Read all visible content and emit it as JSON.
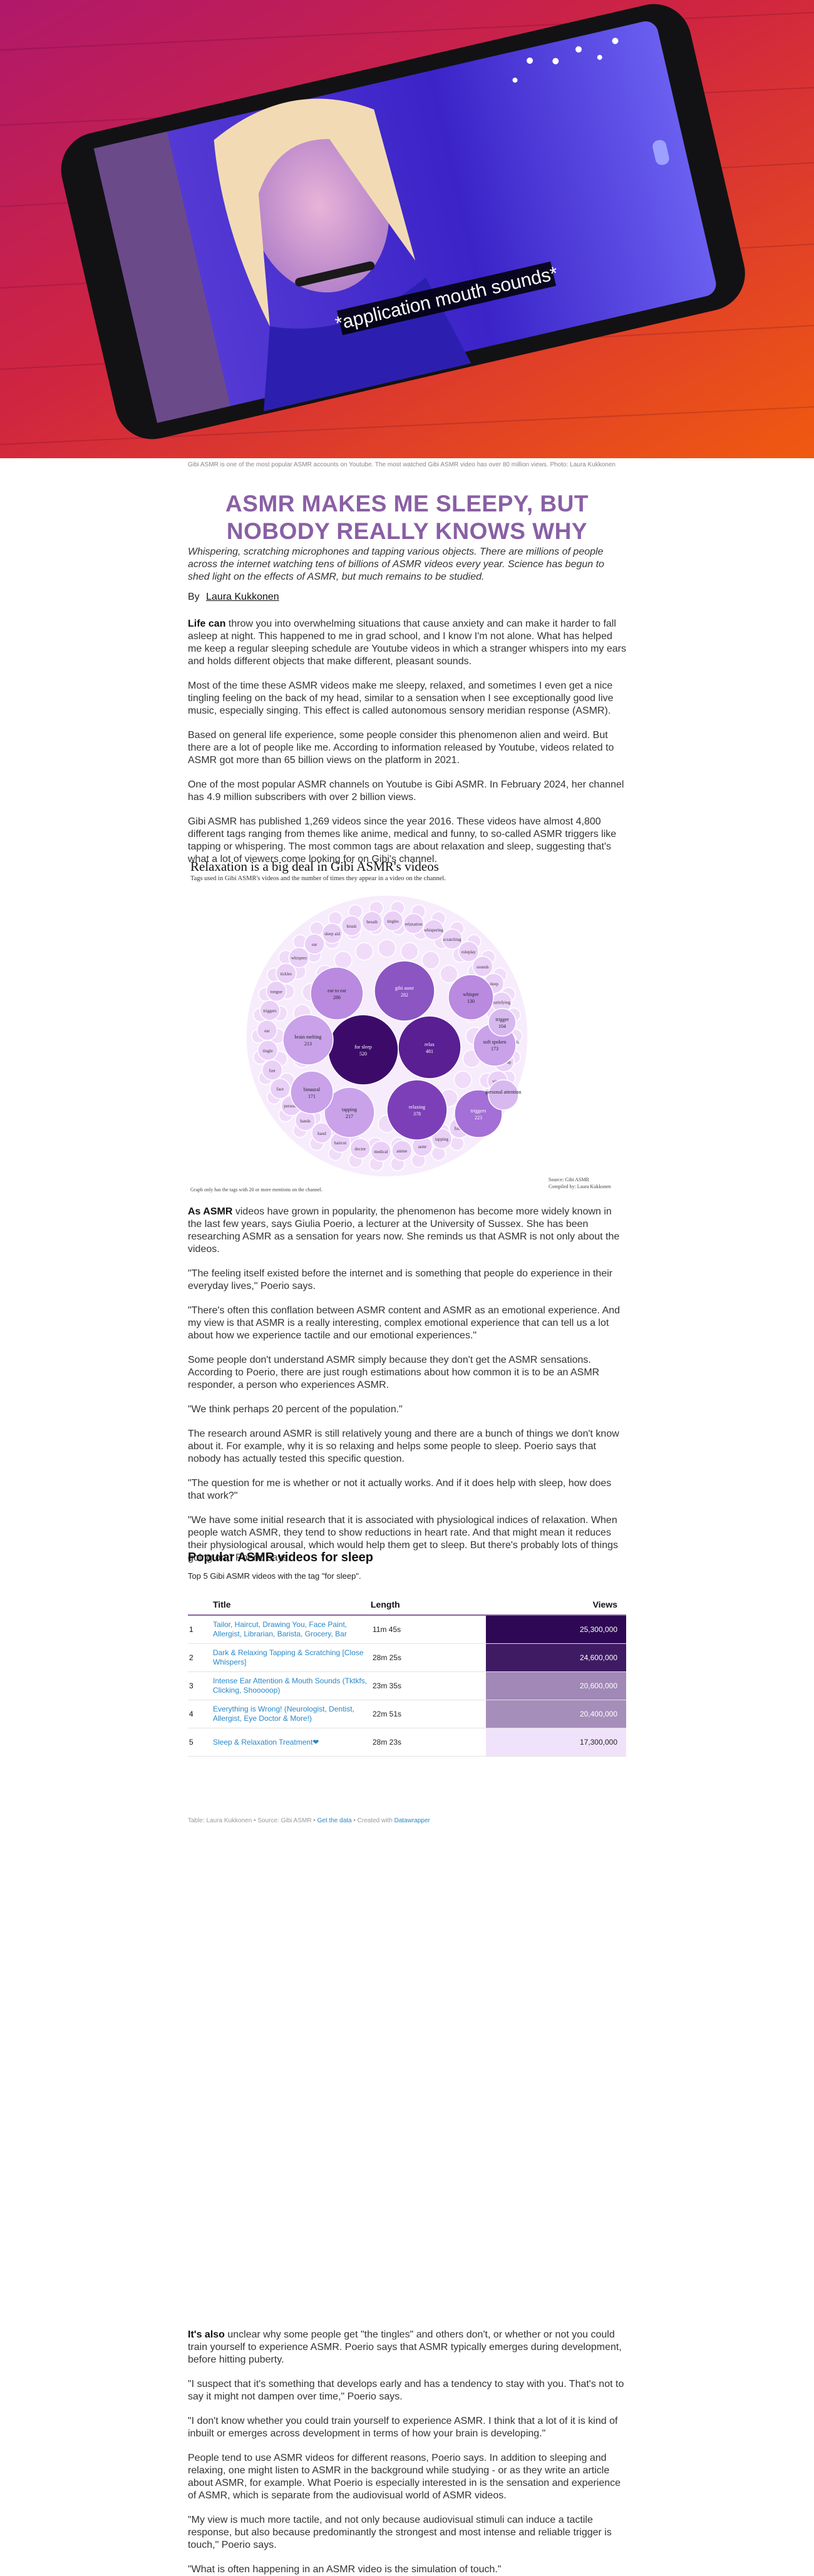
{
  "hero": {
    "subtitle_overlay": "*application mouth sounds*"
  },
  "caption": "Gibi ASMR is one of the most popular ASMR accounts on Youtube. The most watched Gibi ASMR video has over 80 million views. Photo: Laura Kukkonen",
  "headline": "ASMR MAKES ME SLEEPY, BUT NOBODY REALLY KNOWS WHY",
  "lead": "Whispering, scratching microphones and tapping various objects. There are millions of people across the internet watching tens of billions of ASMR videos every year. Science has begun to shed light on the effects of ASMR, but much remains to be studied.",
  "byline": {
    "prefix": "By",
    "author": "Laura Kukkonen"
  },
  "intro_paragraphs": [
    {
      "lead": "Life can",
      "text": " throw you into overwhelming situations that cause anxiety and can make it harder to fall asleep at night. This happened to me in grad school, and I know I'm not alone. What has helped me keep a regular sleeping schedule are Youtube videos in which a stranger whispers into my ears and holds different objects that make different, pleasant sounds."
    },
    {
      "lead": "",
      "text": "Most of the time these ASMR videos make me sleepy, relaxed, and sometimes I even get a nice tingling feeling on the back of my head, similar to a sensation when I see exceptionally good live music, especially singing. This effect is called autonomous sensory meridian response (ASMR)."
    },
    {
      "lead": "",
      "text": "Based on general life experience, some people consider this phenomenon alien and weird. But there are a lot of people like me. According to information released by Youtube, videos related to ASMR got more than 65 billion views on the platform in 2021."
    },
    {
      "lead": "",
      "text": "One of the most popular ASMR channels on Youtube is Gibi ASMR. In February 2024, her channel has 4.9 million subscribers with over 2 billion views."
    },
    {
      "lead": "",
      "text": "Gibi ASMR has published 1,269 videos since the year 2016. These videos have almost 4,800 different tags ranging from themes like anime, medical and funny, to so-called ASMR triggers like tapping or whispering. The most common tags are about relaxation and sleep, suggesting that's what a lot of viewers come looking for on Gibi's channel."
    }
  ],
  "bubble_chart": {
    "title": "Relaxation is a big deal in Gibi ASMR's videos",
    "subtitle": "Tags used in Gibi ASMR's videos and the number of times they appear in a video on the channel.",
    "footnote": "Graph only has the tags with 20 or more mentions on the channel.",
    "source": "Source: Gibi ASMR",
    "compiled": "Compiled by: Laura Kukkonen",
    "big": [
      {
        "label": "for sleep",
        "value": "520"
      },
      {
        "label": "relax",
        "value": "481"
      },
      {
        "label": "relaxing",
        "value": "378"
      },
      {
        "label": "gibi asmr",
        "value": "282"
      },
      {
        "label": "ear to ear",
        "value": "286"
      },
      {
        "label": "brain melting",
        "value": "213"
      },
      {
        "label": "tapping",
        "value": "217"
      },
      {
        "label": "binaural",
        "value": "171"
      },
      {
        "label": "triggers",
        "value": "223"
      },
      {
        "label": "whisper",
        "value": "130"
      },
      {
        "label": "soft spoken",
        "value": "173"
      },
      {
        "label": "trigger",
        "value": "104"
      },
      {
        "label": "personal attention",
        "value": ""
      }
    ],
    "small": [
      "tingles",
      "relaxation",
      "whispering",
      "scratching",
      "roleplay",
      "sounds",
      "sleep",
      "satisfying",
      "brushing",
      "mouth sounds",
      "close up",
      "visual",
      "unintelligible",
      "roleplay",
      "funny",
      "tapping",
      "asmr",
      "anime",
      "medical",
      "doctor",
      "haircut",
      "hand",
      "hands",
      "personal",
      "face",
      "fast",
      "tingle",
      "ear",
      "triggers",
      "tongue",
      "tickles",
      "whispers",
      "ear",
      "sleep aid",
      "brush",
      "breath"
    ]
  },
  "mid_paragraphs": [
    {
      "lead": "As ASMR",
      "text": " videos have grown in popularity, the phenomenon has become more widely known in the last few years, says Giulia Poerio, a lecturer at the University of Sussex. She has been researching ASMR as a sensation for years now. She reminds us that ASMR is not only about the videos."
    },
    {
      "lead": "",
      "text": "\"The feeling itself existed before the internet and is something that people do experience in their everyday lives,\" Poerio says."
    },
    {
      "lead": "",
      "text": "\"There's often this conflation between ASMR content and ASMR as an emotional experience. And my view is that ASMR is a really interesting, complex emotional experience that can tell us a lot about how we experience tactile and our emotional experiences.\""
    },
    {
      "lead": "",
      "text": "Some people don't understand ASMR simply because they don't get the ASMR sensations. According to Poerio, there are just rough estimations about how common it is to be an ASMR responder, a person who experiences ASMR."
    },
    {
      "lead": "",
      "text": "\"We think perhaps 20 percent of the population.\""
    },
    {
      "lead": "",
      "text": "The research around ASMR is still relatively young and there are a bunch of things we don't know about it. For example, why it is so relaxing and helps some people to sleep. Poerio says that nobody has actually tested this specific question."
    },
    {
      "lead": "",
      "text": "\"The question for me is whether or not it actually works. And if it does help with sleep, how does that work?\""
    },
    {
      "lead": "",
      "text": "\"We have some initial research that it is associated with physiological indices of relaxation. When people watch ASMR, they tend to show reductions in heart rate. And that might mean it reduces their physiological arousal, which would help them get to sleep. But there's probably lots of things going on,\" Poerio says."
    }
  ],
  "table_section": {
    "title": "Popular ASMR videos for sleep",
    "subtitle": "Top 5 Gibi ASMR videos with the tag \"for sleep\".",
    "headers": {
      "rank": "",
      "title": "Title",
      "length": "Length",
      "views": "Views"
    },
    "rows": [
      {
        "rank": "1",
        "title": "Tailor, Haircut, Drawing You, Face Paint, Allergist, Librarian, Barista, Grocery, Bar",
        "length": "11m 45s",
        "views": "25,300,000",
        "views_num": 25300000
      },
      {
        "rank": "2",
        "title": "Dark & Relaxing Tapping & Scratching [Close Whispers]",
        "length": "28m 25s",
        "views": "24,600,000",
        "views_num": 24600000
      },
      {
        "rank": "3",
        "title": "Intense Ear Attention & Mouth Sounds (Tktkfs, Clicking, Shooooop)",
        "length": "23m 35s",
        "views": "20,600,000",
        "views_num": 20600000
      },
      {
        "rank": "4",
        "title": "Everything is Wrong! (Neurologist, Dentist, Allergist, Eye Doctor & More!)",
        "length": "22m 51s",
        "views": "20,400,000",
        "views_num": 20400000
      },
      {
        "rank": "5",
        "title": "Sleep & Relaxation Treatment❤",
        "length": "28m 23s",
        "views": "17,300,000",
        "views_num": 17300000
      }
    ],
    "source_prefix": "Table: Laura Kukkonen • Source: Gibi ASMR • ",
    "get_data": "Get the data",
    "created_with": " • Created with ",
    "datawrapper": "Datawrapper",
    "colors": {
      "max": "#2e0854",
      "min": "#f1e2fb"
    }
  },
  "end_paragraphs": [
    {
      "lead": "It's also",
      "text": " unclear why some people get \"the tingles\" and others don't, or whether or not you could train yourself to experience ASMR. Poerio says that ASMR typically emerges during development, before hitting puberty."
    },
    {
      "lead": "",
      "text": "\"I suspect that it's something that develops early and has a tendency to stay with you. That's not to say it might not dampen over time,\" Poerio says."
    },
    {
      "lead": "",
      "text": "\"I don't know whether you could train yourself to experience ASMR. I think that a lot of it is kind of inbuilt or emerges across development in terms of how your brain is developing.\""
    },
    {
      "lead": "",
      "text": "People tend to use ASMR videos for different reasons, Poerio says. In addition to sleeping and relaxing, one might listen to ASMR in the background while studying - or as they write an article about ASMR, for example. What Poerio is especially interested in is the sensation and experience of ASMR, which is separate from the audiovisual world of ASMR videos."
    },
    {
      "lead": "",
      "text": "\"My view is much more tactile, and not only because audiovisual stimuli can induce a tactile response, but also because predominantly the strongest and most intense and reliable trigger is touch,\" Poerio says."
    },
    {
      "lead": "",
      "text": "\"What is often happening in an ASMR video is the simulation of touch.\""
    }
  ]
}
